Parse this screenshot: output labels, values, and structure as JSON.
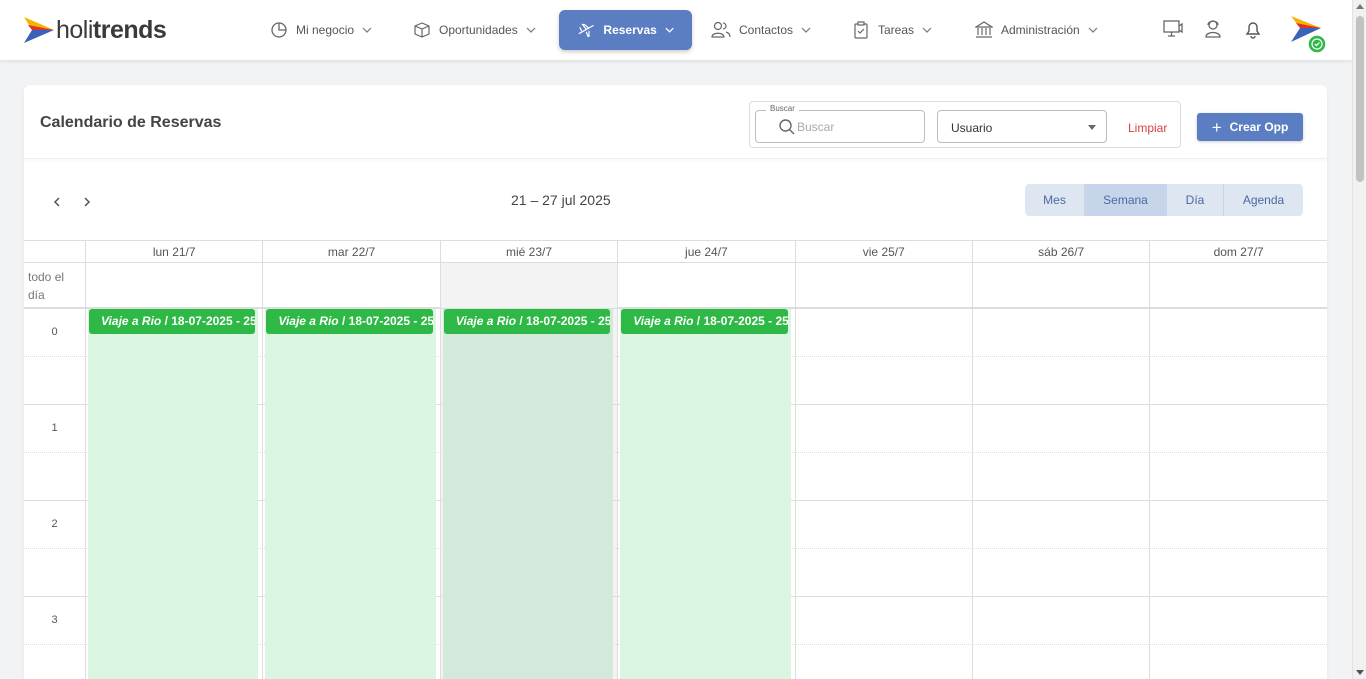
{
  "brand": {
    "logo_part1": "holi",
    "logo_part2": "trends"
  },
  "nav": {
    "items": [
      {
        "id": "mi-negocio",
        "label": "Mi negocio",
        "icon": "pie-chart-icon"
      },
      {
        "id": "oportunidades",
        "label": "Oportunidades",
        "icon": "box-icon"
      },
      {
        "id": "reservas",
        "label": "Reservas",
        "icon": "plane-icon",
        "active": true
      },
      {
        "id": "contactos",
        "label": "Contactos",
        "icon": "users-icon"
      },
      {
        "id": "tareas",
        "label": "Tareas",
        "icon": "clipboard-check-icon"
      },
      {
        "id": "administracion",
        "label": "Administración",
        "icon": "bank-icon"
      }
    ],
    "right_icons": [
      "monitor-icon",
      "support-agent-icon",
      "bell-icon"
    ]
  },
  "page": {
    "title": "Calendario de Reservas",
    "search_legend": "Buscar",
    "search_placeholder": "Buscar",
    "user_select_value": "Usuario",
    "clear_label": "Limpiar",
    "create_label": "Crear Opp",
    "range_label": "21 – 27 jul 2025",
    "views": [
      "Mes",
      "Semana",
      "Día",
      "Agenda"
    ],
    "active_view": "Semana"
  },
  "calendar": {
    "allday_label_1": "todo el",
    "allday_label_2": "día",
    "days": [
      "lun 21/7",
      "mar 22/7",
      "mié 23/7",
      "jue 24/7",
      "vie 25/7",
      "sáb 26/7",
      "dom 27/7"
    ],
    "today": "mié 23/7",
    "hours": [
      "0",
      "1",
      "2",
      "3"
    ],
    "events": [
      {
        "day": "lun 21/7",
        "title": "Viaje a Rio",
        "detail": " / 18-07-2025 - 25"
      },
      {
        "day": "mar 22/7",
        "title": "Viaje a Rio",
        "detail": " / 18-07-2025 - 25"
      },
      {
        "day": "mié 23/7",
        "title": "Viaje a Rio",
        "detail": " / 18-07-2025 - 25"
      },
      {
        "day": "jue 24/7",
        "title": "Viaje a Rio",
        "detail": " / 18-07-2025 - 25"
      }
    ]
  },
  "colors": {
    "accent": "#5b7ec2",
    "event": "#2eb845",
    "event_bg": "#dbf5e3",
    "danger": "#d8403f"
  }
}
